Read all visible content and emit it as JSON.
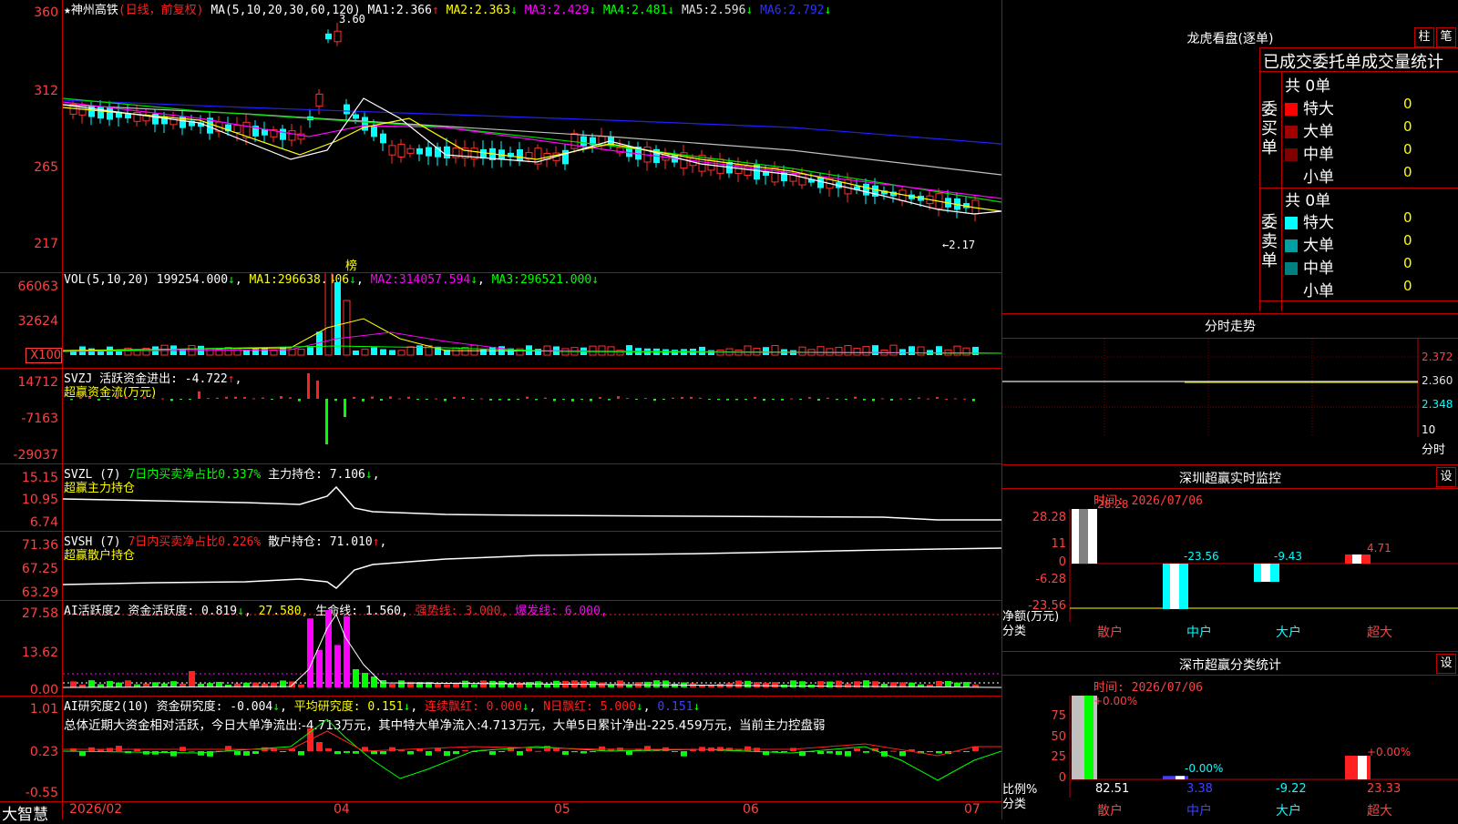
{
  "stock": {
    "name": "★神州高铁",
    "mode": "(日线，前复权)",
    "ma_params": "MA(5,10,20,30,60,120)",
    "ma": [
      {
        "label": "MA1:",
        "value": "2.366",
        "arrow": "↑",
        "color": "#ffffff"
      },
      {
        "label": "MA2:",
        "value": "2.363",
        "arrow": "↓",
        "color": "#ffff00"
      },
      {
        "label": "MA3:",
        "value": "2.429",
        "arrow": "↓",
        "color": "#ff00ff"
      },
      {
        "label": "MA4:",
        "value": "2.481",
        "arrow": "↓",
        "color": "#00ff00"
      },
      {
        "label": "MA5:",
        "value": "2.596",
        "arrow": "↓",
        "color": "#c0c0c0"
      },
      {
        "label": "MA6:",
        "value": "2.792",
        "arrow": "↓",
        "color": "#2020ff"
      }
    ],
    "price_axis": [
      "360",
      "312",
      "265",
      "217"
    ],
    "high_mark": "3.60",
    "low_mark": "←2.17",
    "list_mark": "榜"
  },
  "vol": {
    "header": "VOL(5,10,20)",
    "value": "199254.000",
    "ma": [
      {
        "label": "MA1:",
        "value": "296638.406",
        "color": "#ffff00"
      },
      {
        "label": "MA2:",
        "value": "314057.594",
        "color": "#ff00ff"
      },
      {
        "label": "MA3:",
        "value": "296521.000",
        "color": "#00ff00"
      }
    ],
    "axis": [
      "66063",
      "32624",
      "X100"
    ]
  },
  "svzj": {
    "header": "SVZJ  活跃资金进出: -4.722",
    "subtitle": "超赢资金流(万元)",
    "axis": [
      "14712",
      "-7163",
      "-29037"
    ]
  },
  "svzl": {
    "prefix": "SVZL (7)",
    "ratio": "7日内买卖净占比0.337%",
    "holding": "主力持仓: 7.106",
    "subtitle": "超赢主力持仓",
    "axis": [
      "15.15",
      "10.95",
      "6.74"
    ]
  },
  "svsh": {
    "prefix": "SVSH (7)",
    "ratio": "7日内买卖净占比0.226%",
    "holding": "散户持仓: 71.010",
    "subtitle": "超赢散户持仓",
    "axis": [
      "71.36",
      "67.25",
      "63.29"
    ]
  },
  "ai_active": {
    "prefix": "AI活跃度2",
    "a": "资金活跃度: 0.819",
    "b": "27.580,",
    "c": "生命线: 1.560,",
    "d": "强势线: 3.000,",
    "e": "爆发线: 6.000,",
    "axis": [
      "27.58",
      "13.62",
      "0.00"
    ]
  },
  "ai_research": {
    "prefix": "AI研究度2(10)",
    "a": "资金研究度: -0.004",
    "b": "平均研究度: 0.151",
    "c": "连续飘红: 0.000",
    "d": "N日飘红: 5.000",
    "e": "0.151",
    "summary": "总体近期大资金相对活跃，今日大单净流出:-4.713万元，其中特大单净流入:4.713万元，大单5日累计净出-225.459万元，当前主力控盘弱",
    "axis": [
      "1.01",
      "0.23",
      "-0.55"
    ]
  },
  "xaxis": {
    "brand": "大智慧",
    "labels": [
      "2026/02",
      "04",
      "05",
      "06",
      "07"
    ]
  },
  "lhb": {
    "title": "龙虎看盘(逐单)",
    "btn1": "柱",
    "btn2": "笔",
    "subtitle": "已成交委托单成交量统计",
    "buy": {
      "label": "委买单",
      "total": "共 0单",
      "rows": [
        {
          "name": "特大",
          "value": "0",
          "color": "#ff0000"
        },
        {
          "name": "大单",
          "value": "0",
          "color": "#a00000"
        },
        {
          "name": "中单",
          "value": "0",
          "color": "#800000"
        },
        {
          "name": "小单",
          "value": "0",
          "color": ""
        }
      ]
    },
    "sell": {
      "label": "委卖单",
      "total": "共 0单",
      "rows": [
        {
          "name": "特大",
          "value": "0",
          "color": "#00ffff"
        },
        {
          "name": "大单",
          "value": "0",
          "color": "#00a0a0"
        },
        {
          "name": "中单",
          "value": "0",
          "color": "#008080"
        },
        {
          "name": "小单",
          "value": "0",
          "color": ""
        }
      ]
    }
  },
  "intraday": {
    "title": "分时走势",
    "axis": [
      "2.372",
      "2.360",
      "2.348"
    ],
    "vol_label": "10",
    "time_label": "分时"
  },
  "sz_monitor": {
    "title": "深圳超赢实时监控",
    "set": "设",
    "time": "时间: 2026/07/06",
    "axis": [
      "28.28",
      "11",
      "0",
      "-6.28",
      "-23.56"
    ],
    "unit": "净额(万元)",
    "cat_label": "分类",
    "categories": [
      "散户",
      "中户",
      "大户",
      "超大"
    ],
    "values": [
      "28.28",
      "-23.56",
      "-9.43",
      "4.71"
    ]
  },
  "sz_class": {
    "title": "深市超赢分类统计",
    "set": "设",
    "time": "时间: 2026/07/06",
    "axis": [
      "75",
      "50",
      "25",
      "0"
    ],
    "unit": "比例%",
    "cat_label": "分类",
    "categories": [
      "散户",
      "中户",
      "大户",
      "超大"
    ],
    "top": [
      "+0.00%",
      "-0.00%",
      "",
      "+0.00%"
    ],
    "values": [
      "82.51",
      "3.38",
      "-9.22",
      "23.33"
    ]
  }
}
